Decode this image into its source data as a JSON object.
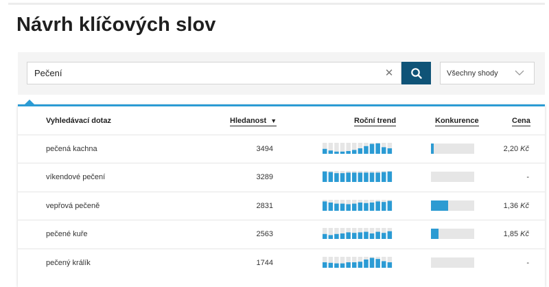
{
  "page": {
    "title": "Návrh klíčových slov"
  },
  "search": {
    "value": "Pečení",
    "clear_icon": "close-icon",
    "submit_icon": "search-icon"
  },
  "match_filter": {
    "selected": "Všechny shody",
    "icon": "chevron-down-icon"
  },
  "colors": {
    "accent": "#2b9bd4",
    "button": "#0f5377",
    "bar_empty": "#e6e6e6"
  },
  "table": {
    "columns": {
      "query": "Vyhledávací dotaz",
      "volume": "Hledanost",
      "trend": "Roční trend",
      "competition": "Konkurence",
      "price": "Cena"
    },
    "sort": {
      "column": "volume",
      "direction": "desc",
      "icon": "sort-down-icon"
    },
    "rows": [
      {
        "query": "pečená kachna",
        "volume": "3494",
        "trend": [
          0.45,
          0.3,
          0.2,
          0.2,
          0.25,
          0.35,
          0.5,
          0.7,
          0.9,
          0.95,
          0.6,
          0.5
        ],
        "competition": 0.07,
        "price": "2,20",
        "currency": "Kč"
      },
      {
        "query": "víkendové pečení",
        "volume": "3289",
        "trend": [
          0.95,
          0.9,
          0.8,
          0.8,
          0.85,
          0.85,
          0.85,
          0.85,
          0.85,
          0.85,
          0.9,
          0.95
        ],
        "competition": 0,
        "price": "-",
        "currency": ""
      },
      {
        "query": "vepřová pečeně",
        "volume": "2831",
        "trend": [
          0.85,
          0.75,
          0.65,
          0.65,
          0.6,
          0.65,
          0.75,
          0.7,
          0.75,
          0.85,
          0.8,
          0.9
        ],
        "competition": 0.4,
        "price": "1,36",
        "currency": "Kč"
      },
      {
        "query": "pečené kuře",
        "volume": "2563",
        "trend": [
          0.45,
          0.35,
          0.45,
          0.5,
          0.6,
          0.55,
          0.6,
          0.65,
          0.5,
          0.65,
          0.55,
          0.7
        ],
        "competition": 0.17,
        "price": "1,85",
        "currency": "Kč"
      },
      {
        "query": "pečený králík",
        "volume": "1744",
        "trend": [
          0.5,
          0.45,
          0.4,
          0.4,
          0.5,
          0.5,
          0.55,
          0.75,
          0.9,
          0.8,
          0.6,
          0.5
        ],
        "competition": 0,
        "price": "-",
        "currency": ""
      }
    ]
  }
}
